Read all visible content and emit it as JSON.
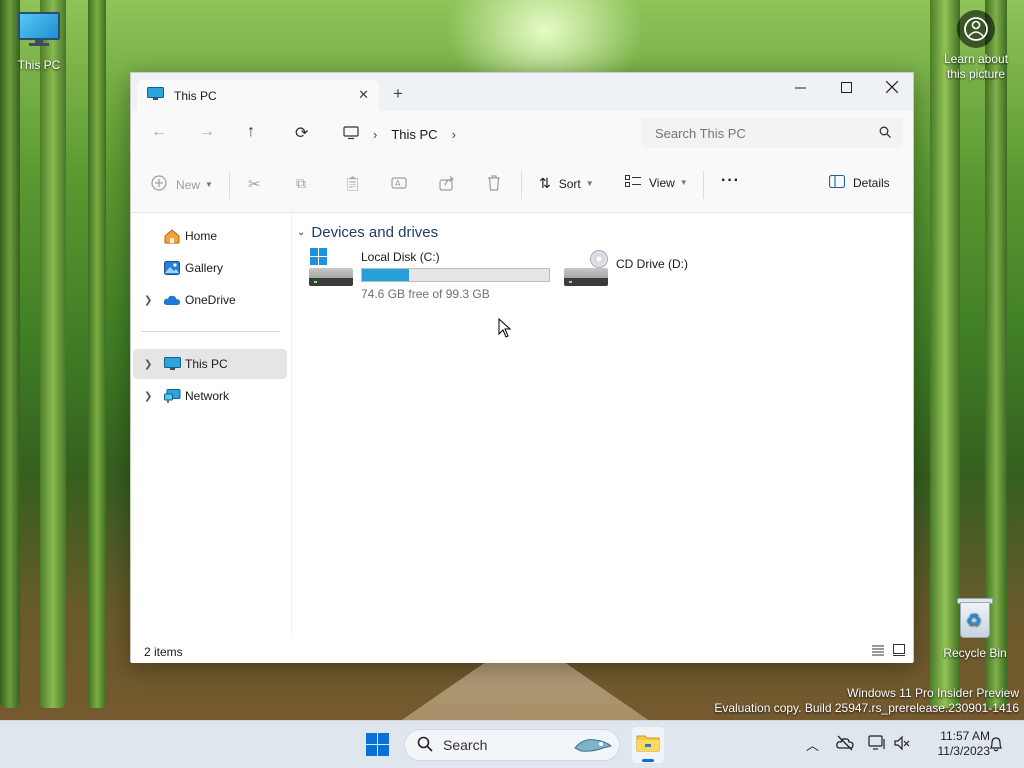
{
  "desktop": {
    "icons": [
      {
        "label": "This PC"
      },
      {
        "label": "Recycle Bin"
      }
    ],
    "learn_label_line1": "Learn about",
    "learn_label_line2": "this picture",
    "watermark_line1": "Windows 11 Pro Insider Preview",
    "watermark_line2": "Evaluation copy. Build 25947.rs_prerelease.230901-1416"
  },
  "window": {
    "tab_title": "This PC",
    "address": {
      "breadcrumb": [
        "This PC"
      ]
    },
    "search_placeholder": "Search This PC",
    "commands": {
      "new": "New",
      "sort": "Sort",
      "view": "View",
      "details": "Details"
    },
    "nav": [
      {
        "label": "Home",
        "expandable": false,
        "selected": false,
        "icon": "home-icon"
      },
      {
        "label": "Gallery",
        "expandable": false,
        "selected": false,
        "icon": "gallery-icon"
      },
      {
        "label": "OneDrive",
        "expandable": true,
        "selected": false,
        "icon": "cloud-icon"
      },
      {
        "label": "This PC",
        "expandable": true,
        "selected": true,
        "icon": "monitor-icon"
      },
      {
        "label": "Network",
        "expandable": true,
        "selected": false,
        "icon": "network-icon"
      }
    ],
    "content": {
      "group_title": "Devices and drives",
      "drives": [
        {
          "name": "Local Disk (C:)",
          "free_text": "74.6 GB free of 99.3 GB",
          "used_fraction": 0.249
        },
        {
          "name": "CD Drive (D:)"
        }
      ]
    },
    "status": {
      "item_count": "2 items"
    }
  },
  "taskbar": {
    "search_label": "Search",
    "time": "11:57 AM",
    "date": "11/3/2023"
  },
  "colors": {
    "accent": "#26a0da",
    "start_blue": "#0a6fd6",
    "selection": "#e5e5e5"
  }
}
